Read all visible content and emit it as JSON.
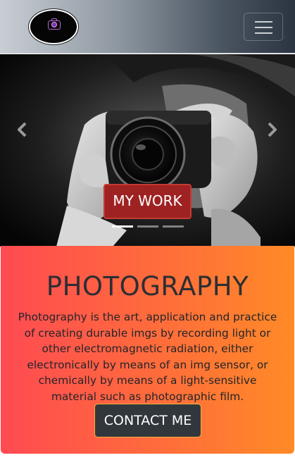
{
  "navbar": {
    "logo_icon": "camera-logo-icon",
    "toggler_icon": "hamburger-icon"
  },
  "carousel": {
    "prev_icon": "chevron-left-icon",
    "next_icon": "chevron-right-icon",
    "caption_button": "MY WORK",
    "slide_count": 3,
    "active_slide": 1
  },
  "about": {
    "title": "PHOTOGRAPHY",
    "text": "Photography is the art, application and practice of creating durable imgs by recording light or other electromagnetic radiation, either electronically by means of an img sensor, or chemically by means of a light-sensitive material such as photographic film.",
    "contact_button": "CONTACT ME"
  },
  "colors": {
    "accent_red": "#9e2222",
    "card_gradient_start": "#ff4a52",
    "card_gradient_end": "#ff8a26",
    "dark_button": "#32373d"
  }
}
